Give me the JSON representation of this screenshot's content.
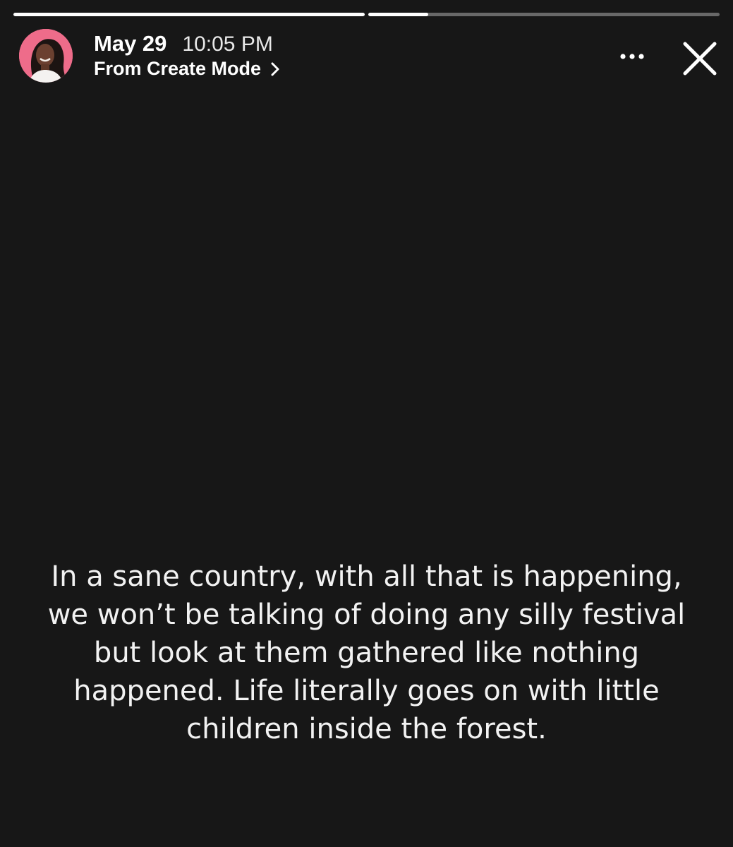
{
  "story": {
    "progress": [
      1.0,
      0.17
    ],
    "date": "May 29",
    "time": "10:05 PM",
    "source_label": "From Create Mode",
    "text": "In a sane country, with all that is happening, we won’t be talking of doing any silly festival but look at them gathered like nothing happened. Life literally goes on with little children inside the forest."
  },
  "icons": {
    "avatar": "profile-photo",
    "source": "chevron-right-icon",
    "more": "more-horizontal-icon",
    "close": "close-icon"
  },
  "colors": {
    "background": "#171717",
    "text": "#ffffff",
    "avatar_ring": "#ee6c8a"
  }
}
